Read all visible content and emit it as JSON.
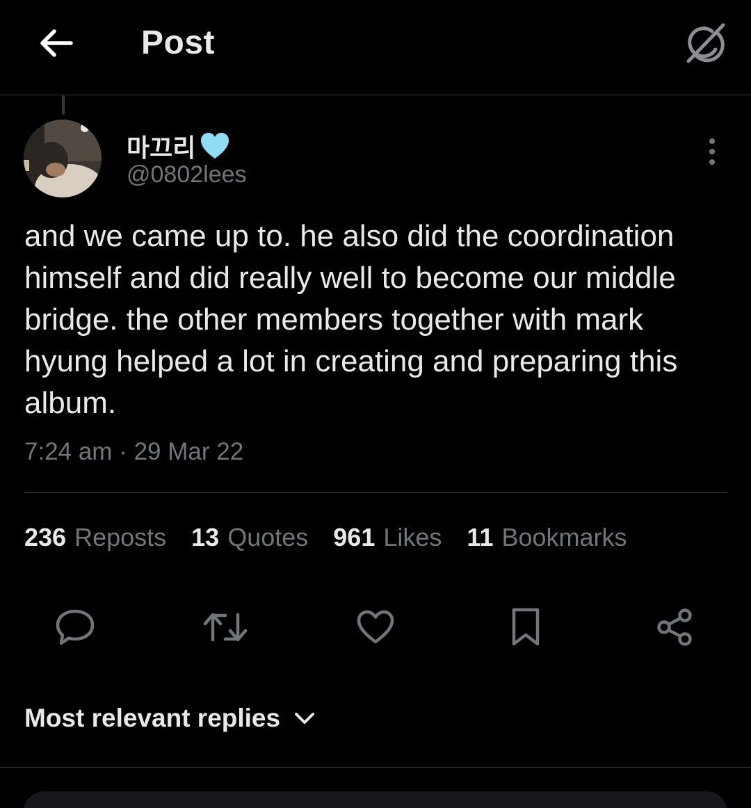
{
  "header": {
    "title": "Post",
    "back_icon": "arrow-left-icon",
    "grok_icon": "grok-icon"
  },
  "author": {
    "display_name": "마끄리",
    "badge": "light-blue-heart-emoji",
    "handle": "@0802lees"
  },
  "post": {
    "text": "and we came up to. he also did the coordination himself and did really well to become our middle bridge. the other members together with mark hyung helped a lot in creating and preparing this album.",
    "timestamp": "7:24 am · 29 Mar 22"
  },
  "stats": [
    {
      "count": "236",
      "label": "Reposts"
    },
    {
      "count": "13",
      "label": "Quotes"
    },
    {
      "count": "961",
      "label": "Likes"
    },
    {
      "count": "11",
      "label": "Bookmarks"
    }
  ],
  "actions": [
    "reply-icon",
    "repost-icon",
    "like-icon",
    "bookmark-icon",
    "share-icon"
  ],
  "replies": {
    "sort_label": "Most relevant replies"
  },
  "colors": {
    "background": "#000000",
    "text": "#e7e9ea",
    "muted": "#71767b",
    "divider": "#2f3336",
    "heart": "#8fdcf5"
  }
}
